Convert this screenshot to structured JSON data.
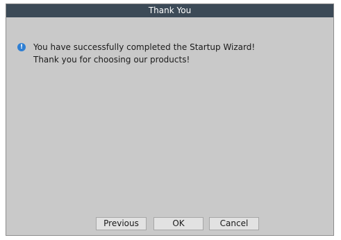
{
  "dialog": {
    "title": "Thank You",
    "message_lines": [
      "You have successfully completed the Startup Wizard!",
      "Thank you for choosing our products!"
    ],
    "icon": "info-icon"
  },
  "buttons": {
    "previous": "Previous",
    "ok": "OK",
    "cancel": "Cancel"
  },
  "colors": {
    "titlebar": "#3c4a57",
    "background": "#c9c9c9",
    "icon": "#2f7fd3"
  }
}
